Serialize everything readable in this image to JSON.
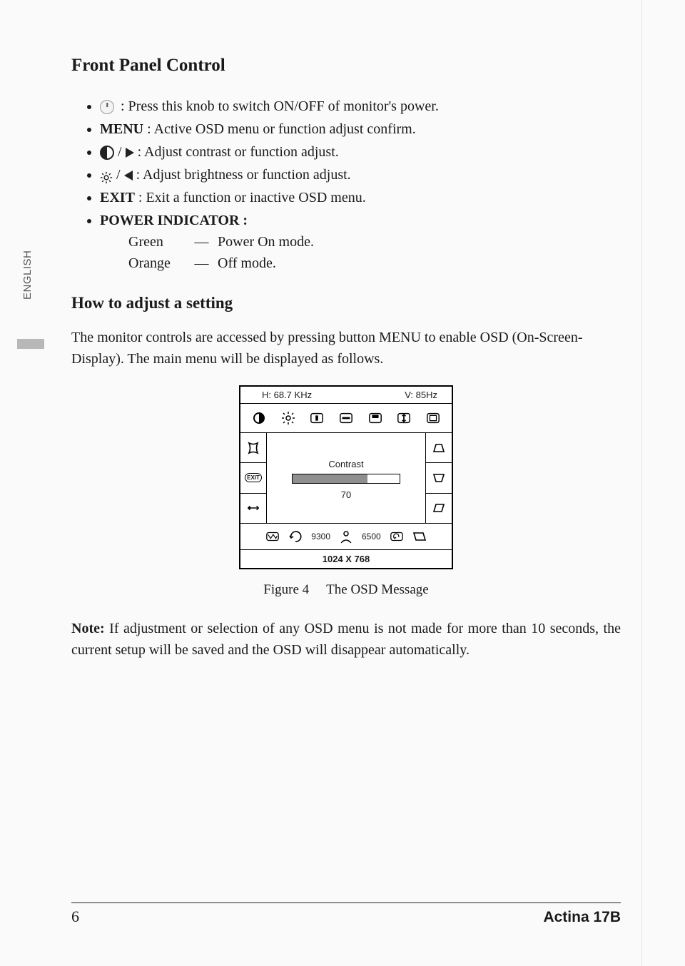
{
  "side_lang": "ENGLISH",
  "section_title": "Front Panel Control",
  "bullets": {
    "power_knob": ": Press this knob to switch ON/OFF of monitor's power.",
    "menu_label": "MENU",
    "menu_text": " : Active OSD menu or function adjust confirm.",
    "contrast_text": " : Adjust contrast or function adjust.",
    "brightness_text": " : Adjust brightness or function adjust.",
    "exit_label": "EXIT",
    "exit_text": " : Exit a function or inactive OSD menu.",
    "power_ind_label": "POWER INDICATOR :",
    "green_label": "Green",
    "green_text": "Power On mode.",
    "orange_label": "Orange",
    "orange_text": "Off mode."
  },
  "subheading": "How to adjust a setting",
  "intro_para": "The monitor controls are accessed by pressing button MENU to enable OSD (On-Screen-Display). The main menu will be displayed as follows.",
  "osd": {
    "h_freq": "H: 68.7 KHz",
    "v_freq": "V: 85Hz",
    "center_label": "Contrast",
    "value": "70",
    "color_temp_a": "9300",
    "color_temp_b": "6500",
    "resolution": "1024 X 768"
  },
  "figure_caption_a": "Figure 4",
  "figure_caption_b": "The  OSD  Message",
  "note_label": "Note:",
  "note_text": " If adjustment or selection of any OSD menu is not made for more than 10 seconds, the current setup will be saved and the OSD will disappear automatically.",
  "footer": {
    "page": "6",
    "brand": "Actina 17B"
  }
}
